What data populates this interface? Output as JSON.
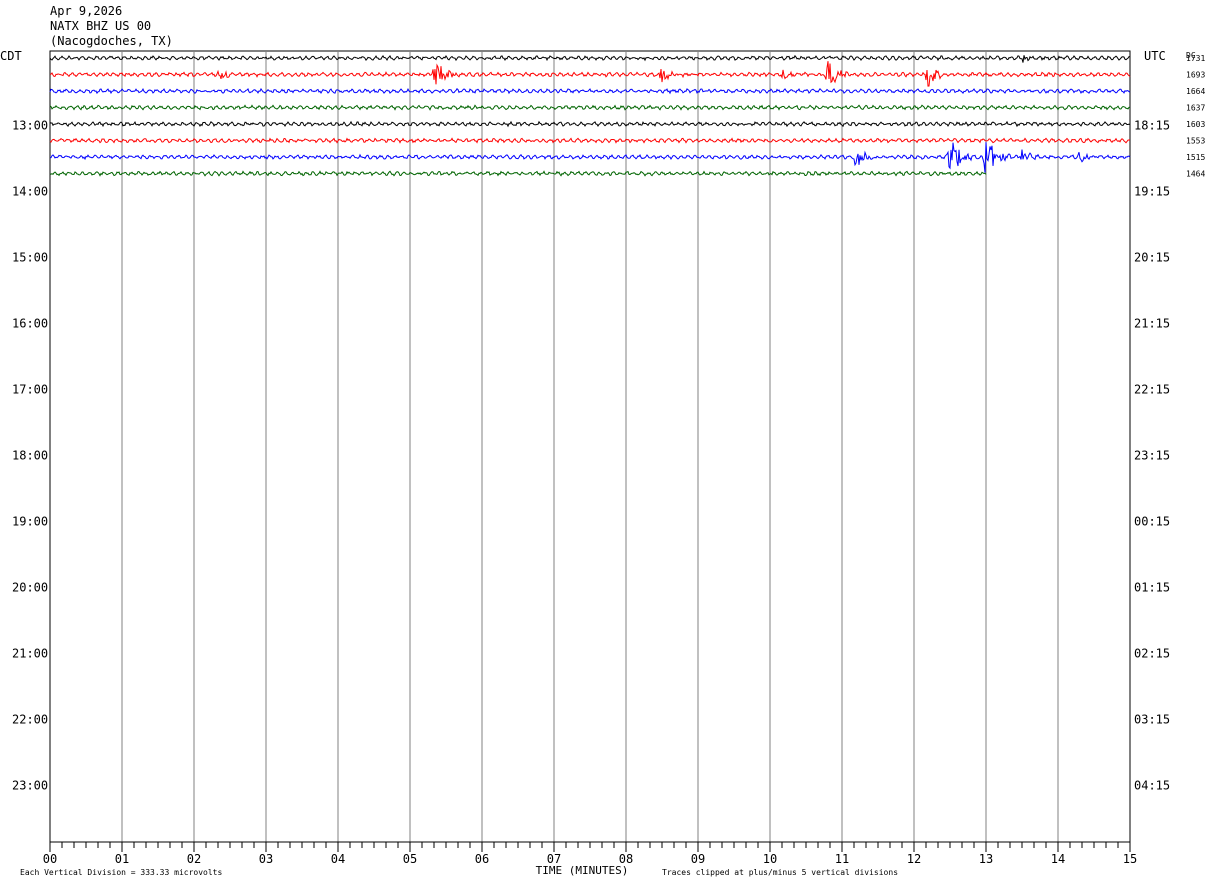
{
  "header": {
    "date": "Apr 9,2026",
    "station": "NATX BHZ US 00",
    "location": "(Nacogdoches, TX)"
  },
  "chart_data": {
    "type": "line",
    "title": "",
    "xlabel": "TIME (MINUTES)",
    "ylabel_left": "CDT",
    "ylabel_right": "UTC",
    "dc_label": "DC",
    "xlim": [
      0,
      15
    ],
    "x_ticks": [
      "00",
      "01",
      "02",
      "03",
      "04",
      "05",
      "06",
      "07",
      "08",
      "09",
      "10",
      "11",
      "12",
      "13",
      "14",
      "15"
    ],
    "left_hour_labels": [
      "13:00",
      "14:00",
      "15:00",
      "16:00",
      "17:00",
      "18:00",
      "19:00",
      "20:00",
      "21:00",
      "22:00",
      "23:00"
    ],
    "right_hour_labels": [
      "18:15",
      "19:15",
      "20:15",
      "21:15",
      "22:15",
      "23:15",
      "00:15",
      "01:15",
      "02:15",
      "03:15",
      "04:15"
    ],
    "trace_colors": [
      "#000000",
      "#ff0000",
      "#0000ff",
      "#006400"
    ],
    "traces": [
      {
        "dc": "1731",
        "end_minute": 15,
        "events": [
          {
            "at": 13.5,
            "amp": 0.6
          }
        ]
      },
      {
        "dc": "1693",
        "end_minute": 15,
        "events": [
          {
            "at": 2.35,
            "amp": 0.6
          },
          {
            "at": 5.35,
            "amp": 1.8
          },
          {
            "at": 8.5,
            "amp": 1.0
          },
          {
            "at": 10.2,
            "amp": 0.7
          },
          {
            "at": 10.8,
            "amp": 2.0
          },
          {
            "at": 12.2,
            "amp": 1.5
          }
        ]
      },
      {
        "dc": "1664",
        "end_minute": 15,
        "events": []
      },
      {
        "dc": "1637",
        "end_minute": 15,
        "events": []
      },
      {
        "dc": "1603",
        "end_minute": 15,
        "events": []
      },
      {
        "dc": "1553",
        "end_minute": 15,
        "events": []
      },
      {
        "dc": "1515",
        "end_minute": 15,
        "events": [
          {
            "at": 11.2,
            "amp": 1.6
          },
          {
            "at": 12.5,
            "amp": 2.5
          },
          {
            "at": 13.0,
            "amp": 3.0
          },
          {
            "at": 13.5,
            "amp": 0.7
          },
          {
            "at": 14.3,
            "amp": 0.6
          }
        ]
      },
      {
        "dc": "1464",
        "end_minute": 13,
        "events": []
      }
    ]
  },
  "footer": {
    "division_note": "Each Vertical Division =  333.33 microvolts",
    "clip_note": "Traces clipped at plus/minus 5 vertical divisions"
  }
}
